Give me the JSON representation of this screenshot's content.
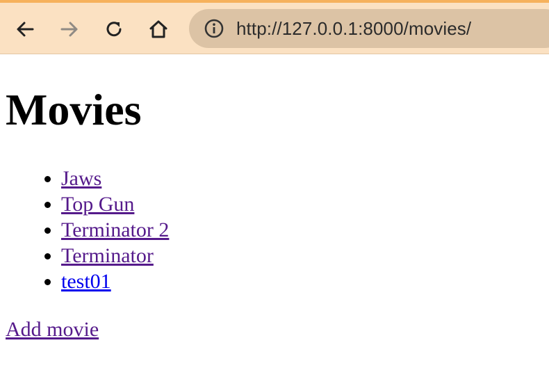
{
  "browser": {
    "url": "http://127.0.0.1:8000/movies/"
  },
  "page": {
    "title": "Movies",
    "movies": [
      {
        "label": "Jaws",
        "visited": true
      },
      {
        "label": "Top Gun",
        "visited": true
      },
      {
        "label": "Terminator 2",
        "visited": true
      },
      {
        "label": "Terminator",
        "visited": true
      },
      {
        "label": "test01",
        "visited": false
      }
    ],
    "add_link": "Add movie"
  },
  "colors": {
    "chrome_bg": "#fbe1c2",
    "address_bg": "#dcc3a5",
    "visited_link": "#551a8b",
    "unvisited_link": "#0000ee"
  }
}
